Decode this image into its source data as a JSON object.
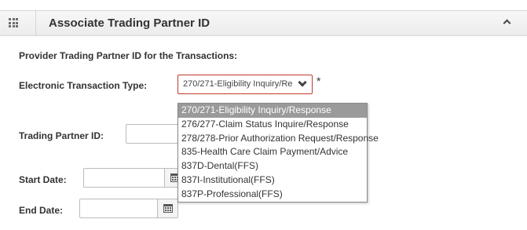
{
  "panel": {
    "title": "Associate Trading Partner ID",
    "icons": {
      "grid": "grid-icon",
      "collapse": "chevron-up-icon"
    }
  },
  "form": {
    "section_label": "Provider Trading Partner ID for the Transactions:",
    "transaction_type": {
      "label": "Electronic Transaction Type:",
      "value": "270/271-Eligibility Inquiry/Response",
      "required_mark": "*",
      "options": [
        "270/271-Eligibility Inquiry/Response",
        "276/277-Claim Status Inquire/Response",
        "278/278-Prior Authorization Request/Response",
        "835-Health Care Claim Payment/Advice",
        "837D-Dental(FFS)",
        "837I-Institutional(FFS)",
        "837P-Professional(FFS)"
      ],
      "highlighted_option": "270/271-Eligibility Inquiry/Response"
    },
    "trading_partner_id": {
      "label": "Trading Partner ID:",
      "value": ""
    },
    "start_date": {
      "label": "Start Date:",
      "value": ""
    },
    "end_date": {
      "label": "End Date:",
      "value": ""
    }
  },
  "colors": {
    "error_border": "#c0392b",
    "highlight": "#9a9a9a",
    "header_bg": "#efefef"
  }
}
